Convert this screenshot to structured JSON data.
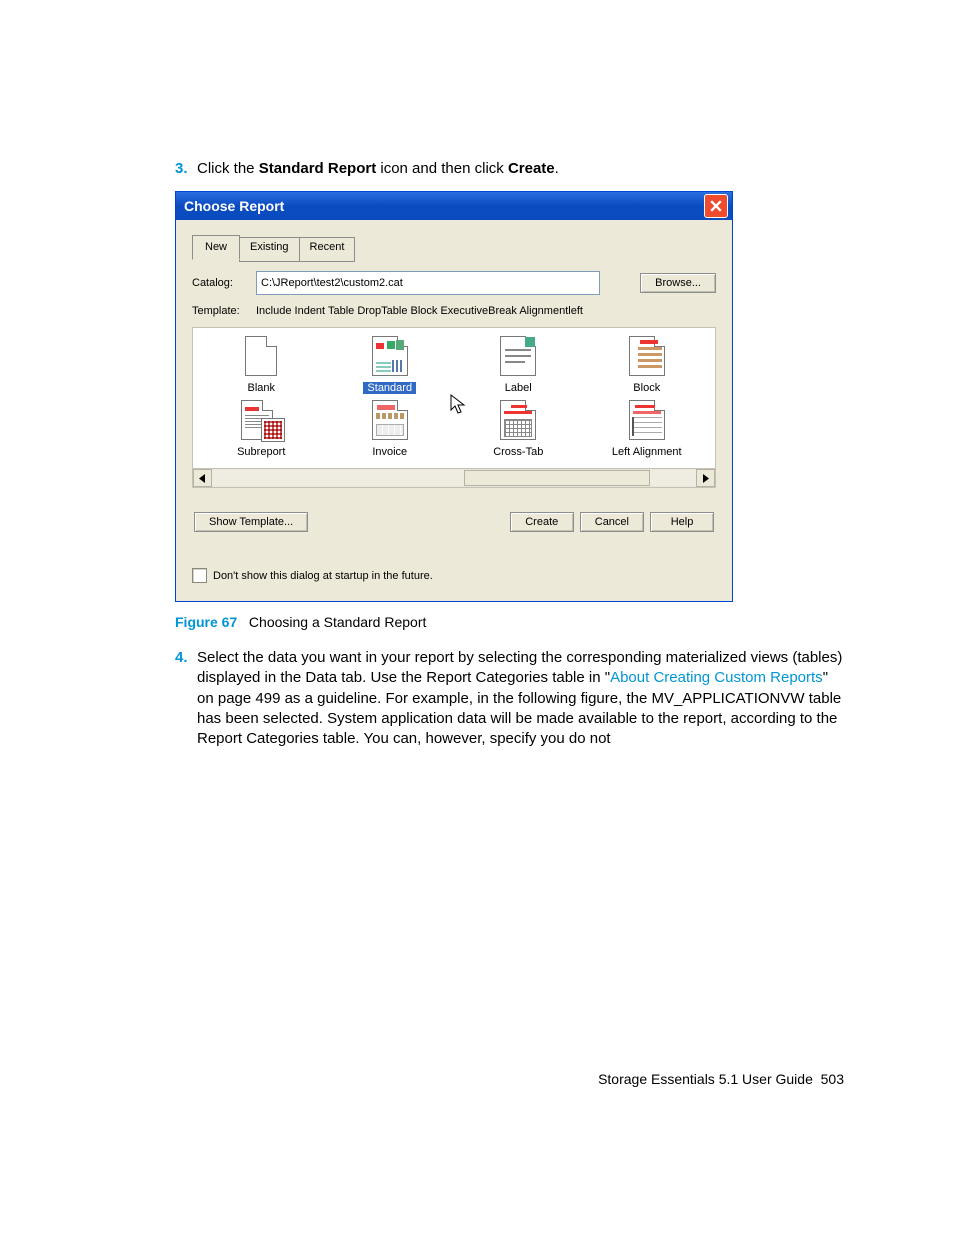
{
  "step3": {
    "num": "3.",
    "text_prefix": "Click the ",
    "bold1": "Standard Report",
    "text_mid": " icon and then click ",
    "bold2": "Create",
    "text_end": "."
  },
  "dialog": {
    "title": "Choose Report",
    "tabs": {
      "new": "New",
      "existing": "Existing",
      "recent": "Recent"
    },
    "catalog_label": "Catalog:",
    "catalog_value": "C:\\JReport\\test2\\custom2.cat",
    "browse": "Browse...",
    "template_label": "Template:",
    "template_desc": "Include Indent Table DropTable Block ExecutiveBreak Alignmentleft",
    "templates": {
      "blank": "Blank",
      "standard": "Standard",
      "label": "Label",
      "block": "Block",
      "subreport": "Subreport",
      "invoice": "Invoice",
      "crosstab": "Cross-Tab",
      "leftalign": "Left Alignment"
    },
    "show_template": "Show Template...",
    "create": "Create",
    "cancel": "Cancel",
    "help": "Help",
    "dont_show": "Don't show this dialog at startup in the future."
  },
  "figure": {
    "label": "Figure 67",
    "caption": "Choosing a Standard Report"
  },
  "step4": {
    "num": "4.",
    "p1": "Select the data you want in your report by selecting the corresponding materialized views (tables) displayed in the Data tab. Use the Report Categories table in \"",
    "link": "About Creating Custom Reports",
    "p2": "\" on page 499 as a guideline. For example, in the following figure, the MV_APPLICATIONVW table has been selected. System application data will be made available to the report, according to the Report Categories table. You can, however, specify you do not"
  },
  "footer": {
    "text": "Storage Essentials 5.1 User Guide",
    "page": "503"
  }
}
